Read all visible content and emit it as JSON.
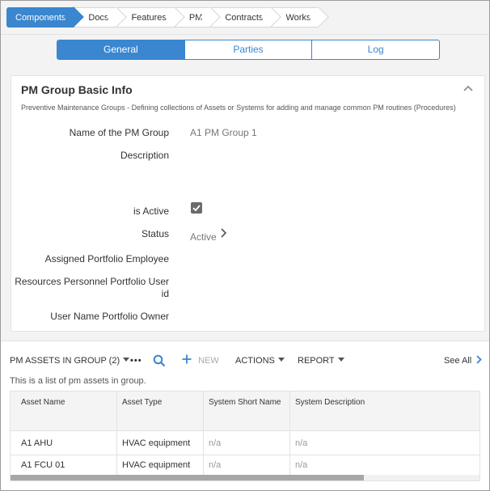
{
  "breadcrumb": [
    {
      "label": "Components",
      "active": true
    },
    {
      "label": "Docs",
      "active": false
    },
    {
      "label": "Features",
      "active": false
    },
    {
      "label": "PM",
      "active": false
    },
    {
      "label": "Contracts",
      "active": false
    },
    {
      "label": "Works",
      "active": false
    }
  ],
  "tabs": [
    {
      "label": "General",
      "active": true
    },
    {
      "label": "Parties",
      "active": false
    },
    {
      "label": "Log",
      "active": false
    }
  ],
  "card": {
    "title": "PM Group Basic Info",
    "subtitle": "Preventive Maintenance Groups - Defining collections of Assets or Systems for adding and manage common PM routines (Procedures)",
    "fields": {
      "name_label": "Name of the PM Group",
      "name_value": "A1 PM Group 1",
      "description_label": "Description",
      "active_label": "is Active",
      "active_checked": true,
      "status_label": "Status",
      "status_value": "Active",
      "employee_label": "Assigned Portfolio Employee",
      "resources_label_line1": "Resources Personnel Portfolio User",
      "resources_label_line2": "id",
      "owner_label": "User Name Portfolio Owner"
    }
  },
  "list": {
    "title": "PM ASSETS IN GROUP (2)",
    "more": "•••",
    "new_label": "NEW",
    "actions_label": "ACTIONS",
    "report_label": "REPORT",
    "see_all_label": "See All",
    "description": "This is a list of pm assets in group.",
    "columns": [
      "Asset Name",
      "Asset Type",
      "System Short Name",
      "System Description"
    ],
    "rows": [
      [
        "A1 AHU",
        "HVAC equipment",
        "n/a",
        "n/a"
      ],
      [
        "A1 FCU 01",
        "HVAC equipment",
        "n/a",
        "n/a"
      ]
    ]
  },
  "colors": {
    "accent": "#3a86cf",
    "checkbox": "#6b6b6b"
  }
}
